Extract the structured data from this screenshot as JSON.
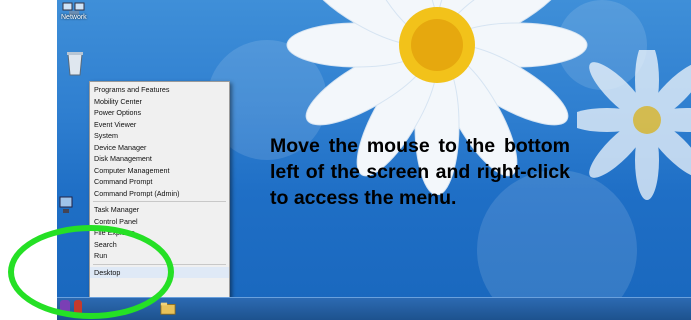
{
  "desktop": {
    "icons": [
      {
        "name": "recycle-bin-icon"
      },
      {
        "name": "network-icon"
      },
      {
        "name": "computer-icon"
      }
    ],
    "network_label": "Network"
  },
  "context_menu": {
    "items": [
      "Programs and Features",
      "Mobility Center",
      "Power Options",
      "Event Viewer",
      "System",
      "Device Manager",
      "Disk Management",
      "Computer Management",
      "Command Prompt",
      "Command Prompt (Admin)"
    ],
    "items_group2": [
      "Task Manager",
      "Control Panel",
      "File Explorer",
      "Search",
      "Run"
    ],
    "items_group3": [
      "Desktop"
    ]
  },
  "instruction": "Move the mouse to the bottom left of the screen and right-click to access the menu.",
  "colors": {
    "highlight_ring": "#25e025",
    "wallpaper": "#2f7fd0",
    "taskbar": "#1d528e"
  }
}
